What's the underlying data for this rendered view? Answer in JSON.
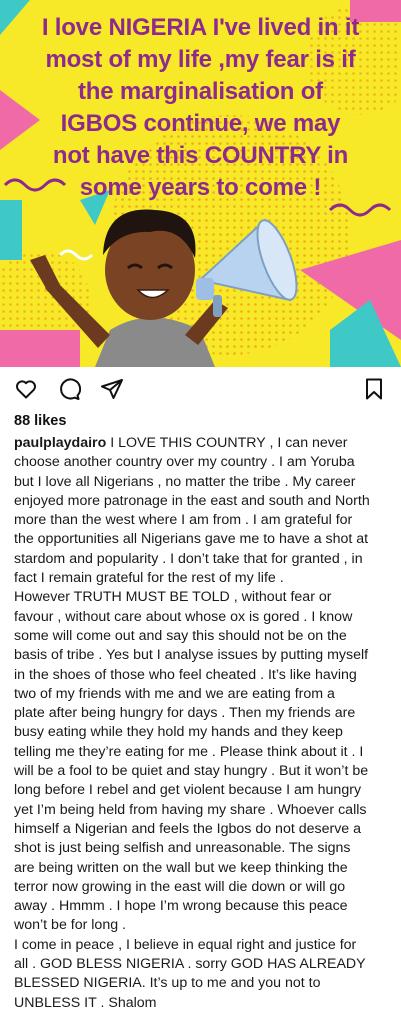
{
  "post": {
    "image": {
      "headline": "I love NIGERIA I've lived in it\nmost of my life ,my fear is if\nthe marginalisation of\nIGBOS continue, we may\nnot have this COUNTRY in\nsome years to come !",
      "headline_color": "#8e2a8e",
      "background_color": "#f7e928"
    },
    "actions": {
      "like_icon": "heart-icon",
      "comment_icon": "comment-icon",
      "share_icon": "send-icon",
      "save_icon": "bookmark-icon"
    },
    "likes": "88 likes",
    "caption": {
      "username": "paulplaydairo",
      "text": " I LOVE THIS COUNTRY , I can never\nchoose another country over my country . I am Yoruba\nbut I love all Nigerians , no matter  the tribe . My career\nenjoyed more patronage in the east and south and North\nmore than the west where I am from . I am grateful for\nthe opportunities all Nigerians gave me to have a shot at\nstardom and popularity . I don’t take that for granted , in\nfact I remain grateful for the rest of my life .\nHowever TRUTH MUST BE TOLD , without fear or\nfavour , without care about whose ox is gored . I know\nsome will come out and say this should not be on the\nbasis of tribe . Yes but I analyse issues by putting myself\nin the shoes of those who feel cheated . It’s like having\ntwo of my friends with me and we are eating from a\nplate after being hungry for days . Then my friends are\nbusy eating while they hold my hands and they keep\ntelling me they’re eating for me . Please think about it . I\nwill be a fool to be quiet and stay hungry . But it won’t be\nlong before I rebel and get violent because I am hungry\nyet I’m being held from having my share . Whoever calls\nhimself a Nigerian and feels the Igbos do not deserve a\nshot is just being selfish and unreasonable. The signs\nare being written on the wall but we keep thinking the\nterror now growing in the east will die down or will go\naway . Hmmm . I hope I’m wrong because this peace\nwon’t be for long .\nI come in peace , I believe in equal right and justice for\nall . GOD BLESS NIGERIA . sorry GOD HAS ALREADY\nBLESSED NIGERIA. It’s up to me and you not to\nUNBLESS  IT . Shalom"
    }
  }
}
